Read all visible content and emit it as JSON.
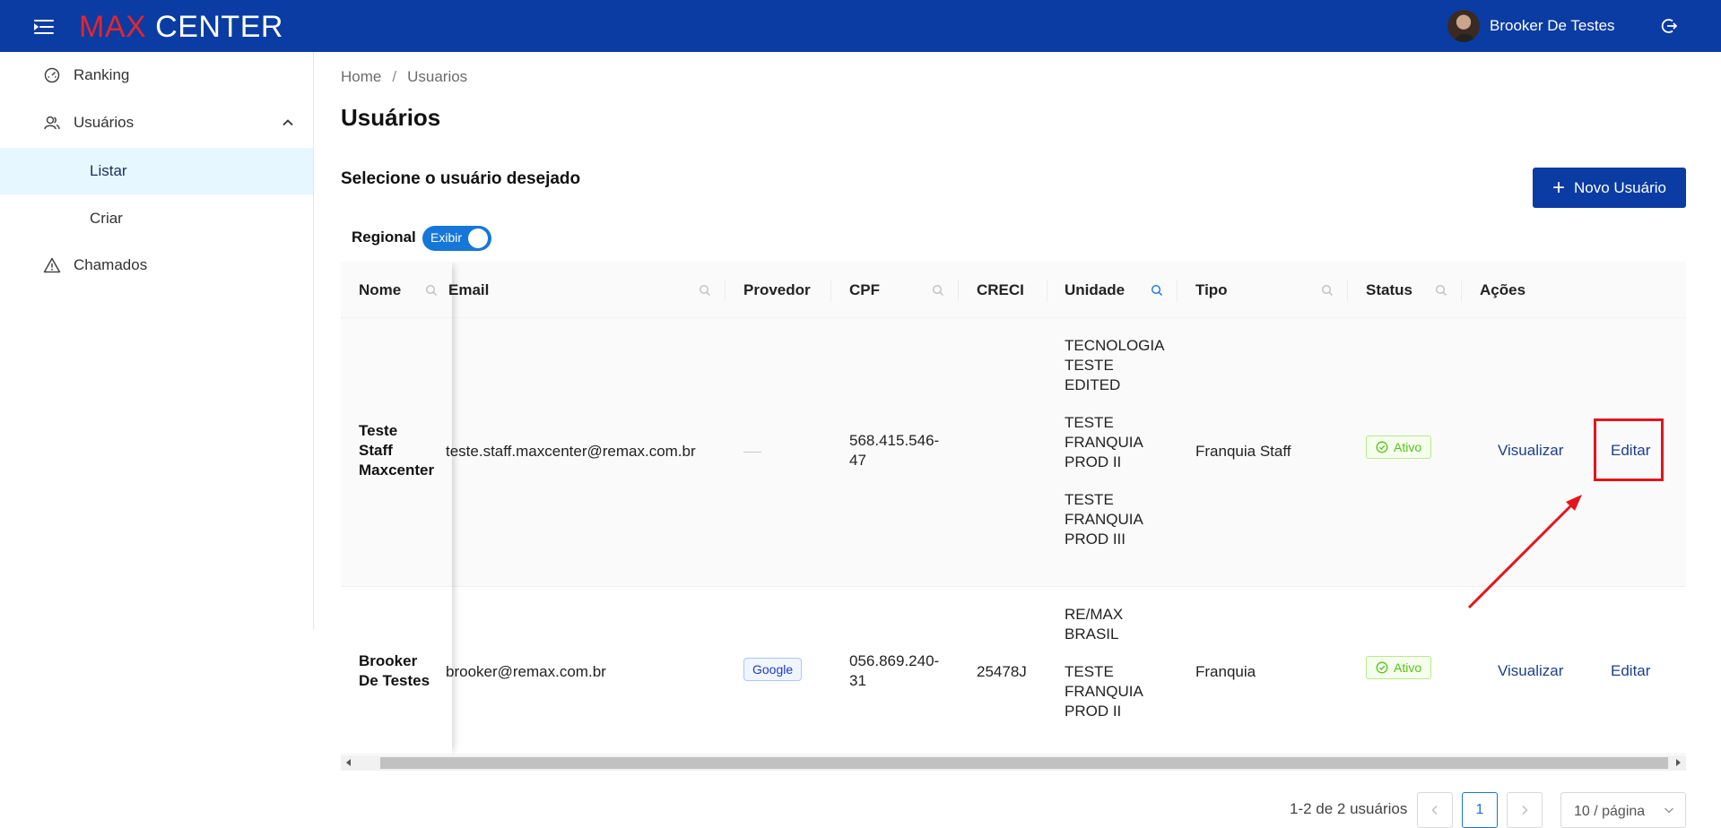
{
  "app": {
    "logo_max": "MAX",
    "logo_center": "CENTER",
    "user_name": "Brooker De Testes"
  },
  "colors": {
    "topbar": "#0a3ca3",
    "logo_red": "#e8242b",
    "accent": "#1677d8",
    "active_nav": "#e6f7ff",
    "highlight": "#e3141c"
  },
  "sidebar": {
    "items": [
      {
        "label": "Ranking",
        "icon": "dashboard-icon"
      },
      {
        "label": "Usuários",
        "icon": "users-icon",
        "expanded": true
      },
      {
        "label": "Listar",
        "active": true
      },
      {
        "label": "Criar"
      },
      {
        "label": "Chamados",
        "icon": "warning-icon"
      }
    ]
  },
  "breadcrumb": {
    "home": "Home",
    "separator": "/",
    "current": "Usuarios"
  },
  "page": {
    "title": "Usuários",
    "section_title": "Selecione o usuário desejado",
    "new_button": "Novo Usuário",
    "regional_label": "Regional",
    "toggle_text": "Exibir",
    "toggle_on": true
  },
  "table": {
    "columns": [
      "Nome",
      "Email",
      "Provedor",
      "CPF",
      "CRECI",
      "Unidade",
      "Tipo",
      "Status",
      "Ações"
    ],
    "rows": [
      {
        "name": [
          "Teste",
          "Staff",
          "Maxcenter"
        ],
        "email": "teste.staff.maxcenter@remax.com.br",
        "provider": "",
        "cpf": [
          "568.415.546-",
          "47"
        ],
        "creci": "",
        "units": [
          [
            "TECNOLOGIA",
            "TESTE",
            "EDITED"
          ],
          [
            "TESTE",
            "FRANQUIA",
            "PROD II"
          ],
          [
            "TESTE",
            "FRANQUIA",
            "PROD III"
          ]
        ],
        "type": "Franquia Staff",
        "status": "Ativo",
        "view": "Visualizar",
        "edit": "Editar"
      },
      {
        "name": [
          "Brooker",
          "De Testes"
        ],
        "email": "brooker@remax.com.br",
        "provider": "Google",
        "cpf": [
          "056.869.240-",
          "31"
        ],
        "creci": "25478J",
        "units": [
          [
            "RE/MAX",
            "BRASIL"
          ],
          [
            "TESTE",
            "FRANQUIA",
            "PROD II"
          ]
        ],
        "type": "Franquia",
        "status": "Ativo",
        "view": "Visualizar",
        "edit": "Editar"
      }
    ]
  },
  "pagination": {
    "total": "1-2 de 2 usuários",
    "current_page": "1",
    "page_size": "10 / página"
  }
}
